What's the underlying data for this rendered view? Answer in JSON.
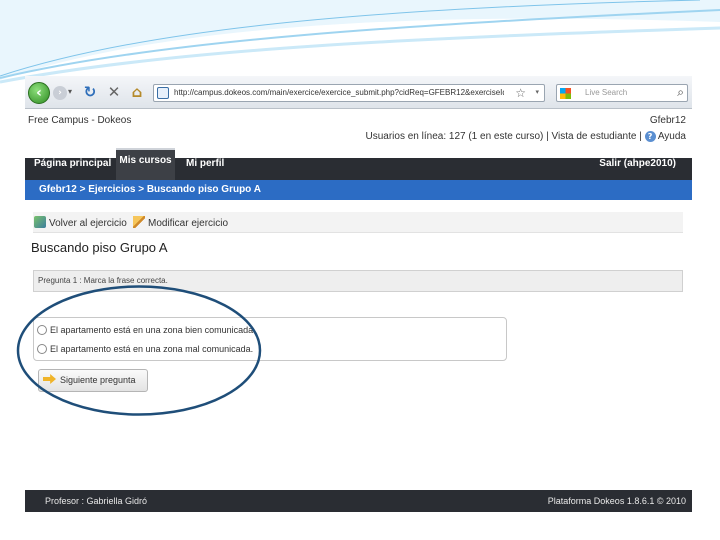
{
  "colors": {
    "nav_bg": "#2a2d33",
    "breadcrumb_bg": "#2c6cc4",
    "swoosh": "#7fc4ea",
    "annotation_ellipse": "#1f4e79"
  },
  "browser": {
    "address": "http://campus.dokeos.com/main/exercice/exercice_submit.php?cidReq=GFEBR12&exerciseId=2",
    "search_placeholder": "Live Search",
    "icons": [
      "back-icon",
      "forward-icon",
      "refresh-icon",
      "stop-icon",
      "home-icon",
      "favicon-icon",
      "star-icon",
      "search-icon"
    ]
  },
  "site": {
    "title": "Free Campus - Dokeos",
    "course_code": "Gfebr12",
    "online_text": "Usuarios en línea: 127 (1 en este curso) | Vista de estudiante |",
    "help_label": "Ayuda"
  },
  "nav": {
    "home": "Página principal",
    "courses": "Mis cursos",
    "profile": "Mi perfil",
    "logout": "Salir (ahpe2010)"
  },
  "breadcrumb": "Gfebr12 > Ejercicios > Buscando piso Grupo A",
  "actions": {
    "back": "Volver al ejercicio",
    "edit": "Modificar ejercicio"
  },
  "exercise": {
    "title": "Buscando piso Grupo A",
    "question": "Pregunta 1 : Marca la frase correcta.",
    "answers": [
      "El apartamento está en una zona bien comunicada.",
      "El apartamento está en una zona mal comunicada."
    ],
    "next_button": "Siguiente pregunta"
  },
  "footer": {
    "teacher": "Profesor : Gabriella Gidró",
    "platform": "Plataforma Dokeos 1.8.6.1 © 2010"
  }
}
